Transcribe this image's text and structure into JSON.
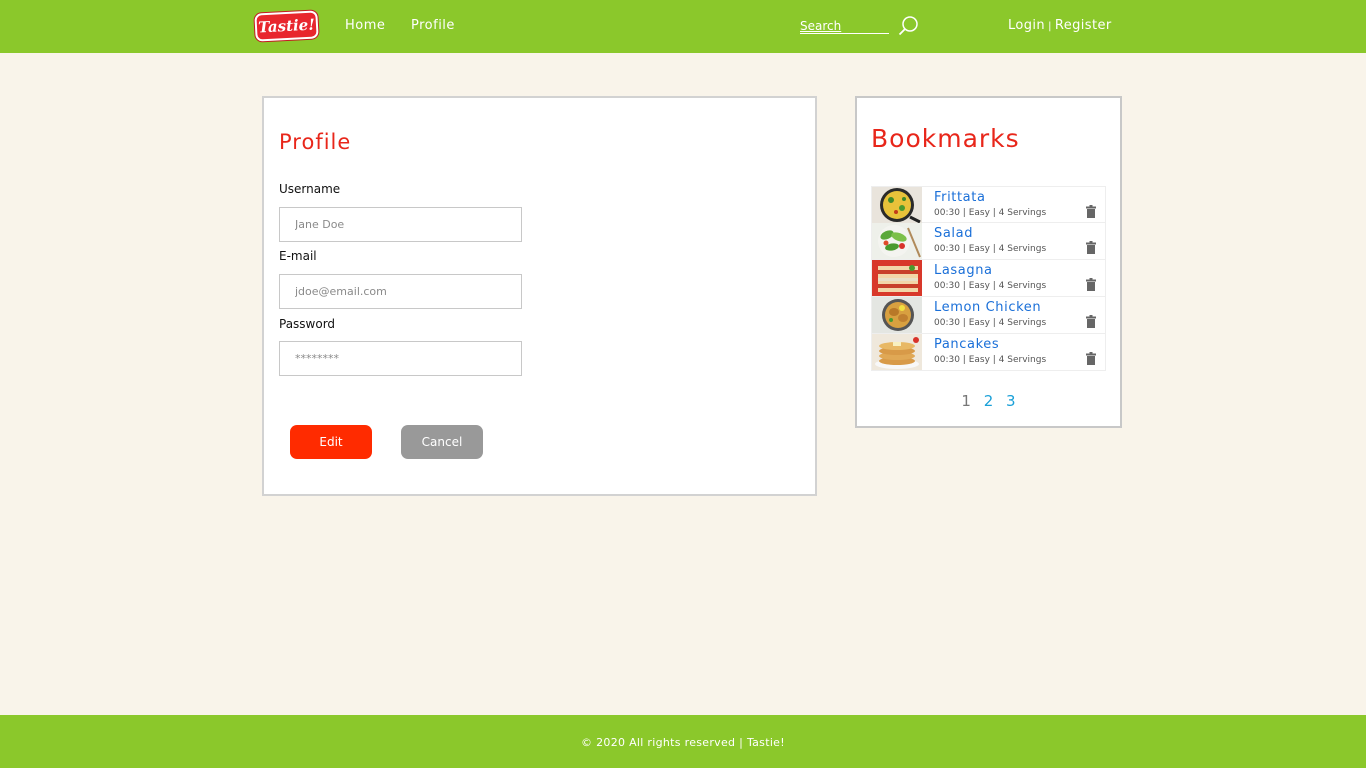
{
  "header": {
    "logo": "Tastie!",
    "nav": [
      {
        "label": "Home"
      },
      {
        "label": "Profile"
      }
    ],
    "search_placeholder": "Search",
    "login_label": "Login",
    "separator": "|",
    "register_label": "Register",
    "icons": {
      "search": "search-icon"
    }
  },
  "profile": {
    "title": "Profile",
    "username_label": "Username",
    "username_placeholder": "Jane Doe",
    "email_label": "E-mail",
    "email_placeholder": "jdoe@email.com",
    "password_label": "Password",
    "password_placeholder": "********",
    "edit_label": "Edit",
    "cancel_label": "Cancel"
  },
  "bookmarks": {
    "title": "Bookmarks",
    "items": [
      {
        "name": "Frittata",
        "meta": "00:30 | Easy | 4 Servings"
      },
      {
        "name": "Salad",
        "meta": "00:30 | Easy | 4 Servings"
      },
      {
        "name": "Lasagna",
        "meta": "00:30 | Easy | 4 Servings"
      },
      {
        "name": "Lemon Chicken",
        "meta": "00:30 | Easy | 4 Servings"
      },
      {
        "name": "Pancakes",
        "meta": "00:30 | Easy | 4 Servings"
      }
    ],
    "pages": [
      "1",
      "2",
      "3"
    ]
  },
  "footer": {
    "text": "© 2020 All rights reserved | Tastie!"
  },
  "colors": {
    "brand_green": "#8bc82b",
    "accent_red": "#e8261a",
    "edit_button": "#ff2b00",
    "cancel_button": "#999999",
    "link_blue": "#1a6fd8",
    "background": "#f9f4ea"
  }
}
